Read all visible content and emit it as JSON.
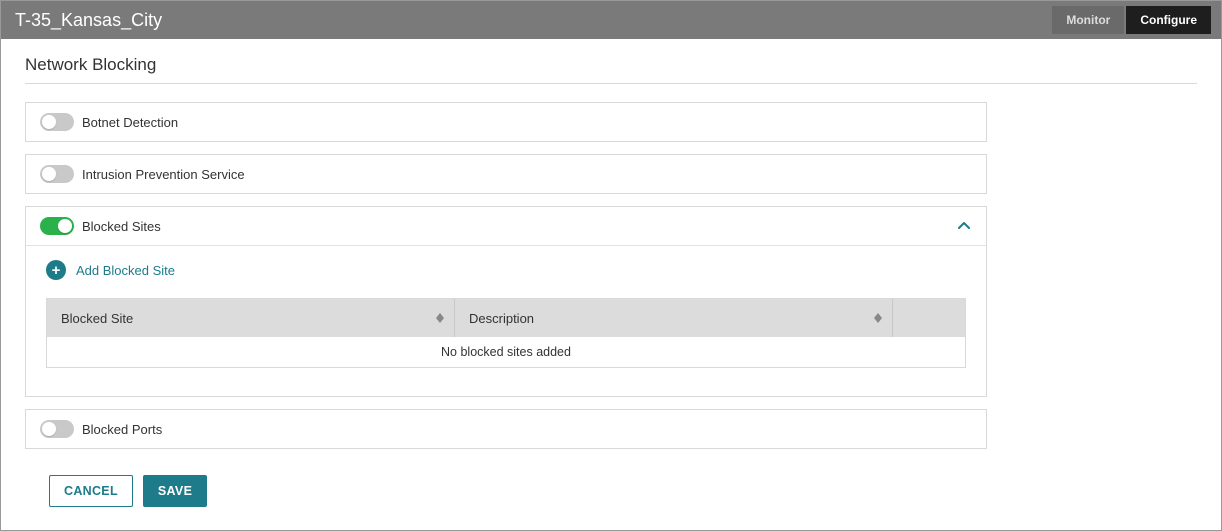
{
  "header": {
    "title": "T-35_Kansas_City",
    "tabs": {
      "monitor": "Monitor",
      "configure": "Configure"
    }
  },
  "section": {
    "title": "Network Blocking"
  },
  "panels": {
    "botnet": {
      "label": "Botnet Detection",
      "on": false
    },
    "ips": {
      "label": "Intrusion Prevention Service",
      "on": false
    },
    "blockedSites": {
      "label": "Blocked Sites",
      "on": true,
      "addLabel": "Add Blocked Site",
      "table": {
        "col1": "Blocked Site",
        "col2": "Description",
        "empty": "No blocked sites added"
      }
    },
    "blockedPorts": {
      "label": "Blocked Ports",
      "on": false
    }
  },
  "footer": {
    "cancel": "CANCEL",
    "save": "SAVE"
  }
}
